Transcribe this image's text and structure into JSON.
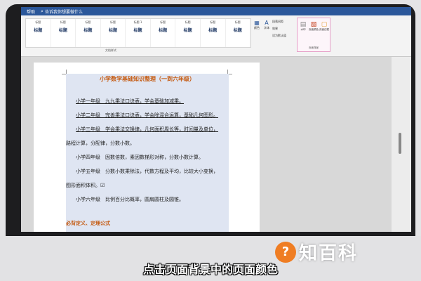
{
  "titlebar": {
    "menu_label": "帮助",
    "search_icon": "search-icon",
    "search_text": "告诉我你想要做什么"
  },
  "ribbon": {
    "styles_group_label": "文档样式",
    "style_tiles": [
      {
        "name": "标题",
        "sample": "标题"
      },
      {
        "name": "标题",
        "sample": "标题"
      },
      {
        "name": "标题",
        "sample": "标题"
      },
      {
        "name": "标题",
        "sample": "标题"
      },
      {
        "name": "标题 1",
        "sample": "标题"
      },
      {
        "name": "标题",
        "sample": "标题"
      },
      {
        "name": "标题",
        "sample": "标题"
      },
      {
        "name": "标题",
        "sample": "标题"
      },
      {
        "name": "标题",
        "sample": "标题"
      }
    ],
    "edit_group": {
      "colors_label": "颜色",
      "fonts_label": "字体",
      "para_spacing": "段落间距",
      "effects": "效果",
      "set_default": "设为默认值"
    },
    "page_background_group": {
      "label": "页面背景",
      "buttons": [
        {
          "label": "水印"
        },
        {
          "label": "页面颜色"
        },
        {
          "label": "页面边框"
        }
      ]
    }
  },
  "document": {
    "title": "小学数学基础知识整理（一到六年级）",
    "lines": [
      "小学一年级　九九乘法口诀表，学会基础加减乘。",
      "小学二年级　完善乘法口诀表，学会除混合运算，基础几何图形。",
      "小学三年级　学会乘法交换律，几何面积周长等，时间量及单位，",
      "路程计算，分配律，分数小数。",
      "小学四年级　因数倍数，素因数梯形对称，分数小数计算。",
      "小学五年级　分数小数乘除法，代数方程及平均，比较大小变换，",
      "图形面积体积。☑",
      "小学六年级　比例百分比概率，圆扇圆柱及圆锥。"
    ],
    "section_heading": "必背定义、定理公式"
  },
  "caption": "点击页面背景中的页面颜色",
  "watermark": {
    "logo_mark": "?",
    "logo_text": "知百科"
  },
  "colors": {
    "titlebar": "#2b579a",
    "accent_orange": "#c55a11",
    "page_bg_highlight": "#dfe5f2"
  }
}
